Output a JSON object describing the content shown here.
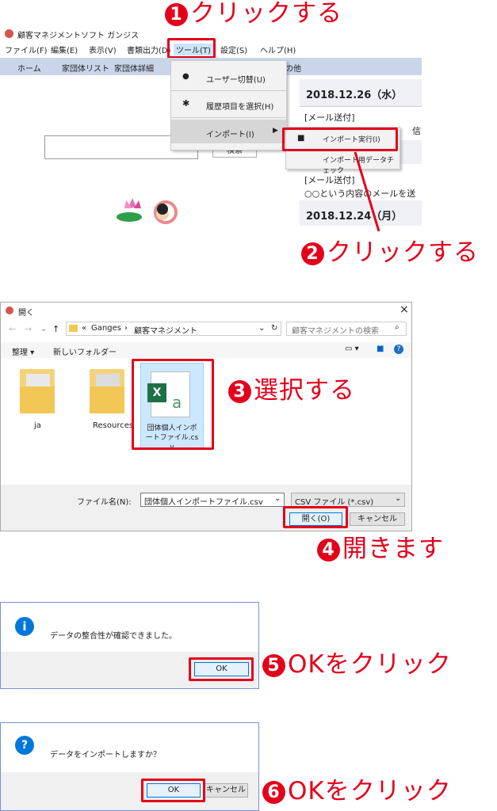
{
  "annotations": {
    "a1": {
      "num": "1",
      "text": "クリックする"
    },
    "a2": {
      "num": "2",
      "text": "クリックする"
    },
    "a3": {
      "num": "3",
      "text": "選択する"
    },
    "a4": {
      "num": "4",
      "text": "開きます"
    },
    "a5": {
      "num": "5",
      "text": "OKをクリック"
    },
    "a6": {
      "num": "6",
      "text": "OKをクリック"
    }
  },
  "app": {
    "title": "顧客マネジメントソフト ガンジス",
    "menus": [
      "ファイル(F)",
      "編集(E)",
      "表示(V)",
      "書類出力(D)",
      "ツール(T)",
      "設定(S)",
      "ヘルプ(H)"
    ],
    "nav": [
      "ホーム",
      "家団体リスト",
      "家団体詳細",
      "の他"
    ],
    "search_button": "検索",
    "tools_menu": {
      "user_switch": "ユーザー切替(U)",
      "history_select": "履歴項目を選択(H)",
      "import": "インポート(I)"
    },
    "import_submenu": {
      "run": "インポート実行(I)",
      "check": "インポート用データチェック"
    },
    "history": {
      "date1": "2018.12.26（水）",
      "tag1": "[メール送付]",
      "text1": "信",
      "tag2": "[メール送付]",
      "text2": "○○という内容のメールを送信",
      "date2": "2018.12.24（月）"
    }
  },
  "open_dialog": {
    "title": "開く",
    "path": [
      "«",
      "Ganges",
      "›",
      "顧客マネジメント"
    ],
    "search_placeholder": "顧客マネジメントの検索",
    "organize": "整理 ▾",
    "new_folder": "新しいフォルダー",
    "items": [
      {
        "name": "ja",
        "type": "folder"
      },
      {
        "name": "Resources",
        "type": "folder"
      },
      {
        "name": "団体個人インポートファイル.csv",
        "type": "csv"
      }
    ],
    "filename_label": "ファイル名(N):",
    "filename_value": "団体個人インポートファイル.csv",
    "filetype_value": "CSV ファイル (*.csv)",
    "open_button": "開く(O)",
    "cancel_button": "キャンセル"
  },
  "info_dialog": {
    "message": "データの整合性が確認できました。",
    "ok": "OK"
  },
  "confirm_dialog": {
    "message": "データをインポートしますか？",
    "ok": "OK",
    "cancel": "キャンセル"
  },
  "colors": {
    "accent_red": "#e3001b",
    "nav_bg": "#c9d6ea",
    "dialog_blue": "#0078d7",
    "excel_green": "#1e7145"
  }
}
